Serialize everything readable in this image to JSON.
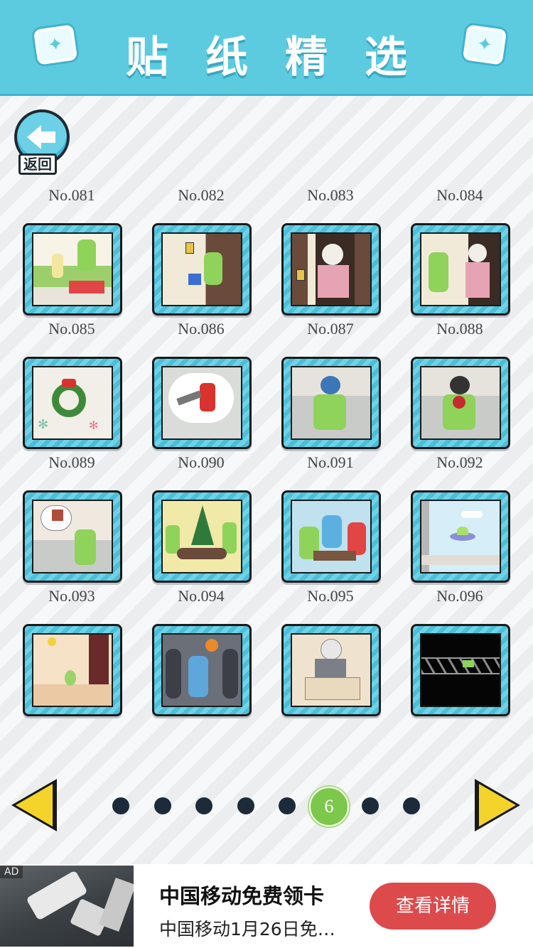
{
  "header": {
    "title": "贴纸精选",
    "left_icon": "star-card-icon",
    "right_icon": "star-card-icon"
  },
  "back_button": {
    "label": "返回",
    "icon": "arrow-left-icon"
  },
  "stickers": [
    {
      "label": "No.081",
      "scene": "boy-and-girl-outdoor"
    },
    {
      "label": "No.082",
      "scene": "boy-at-door"
    },
    {
      "label": "No.083",
      "scene": "woman-in-doorway"
    },
    {
      "label": "No.084",
      "scene": "delivery-at-door"
    },
    {
      "label": "No.085",
      "scene": "christmas-wreath"
    },
    {
      "label": "No.086",
      "scene": "santa-thought-bubble"
    },
    {
      "label": "No.087",
      "scene": "boy-holding-head"
    },
    {
      "label": "No.088",
      "scene": "boy-with-flowers"
    },
    {
      "label": "No.089",
      "scene": "boy-thinking-gift"
    },
    {
      "label": "No.090",
      "scene": "christmas-party"
    },
    {
      "label": "No.091",
      "scene": "friends-at-table"
    },
    {
      "label": "No.092",
      "scene": "ufo-window"
    },
    {
      "label": "No.093",
      "scene": "vase-room"
    },
    {
      "label": "No.094",
      "scene": "basketball-crowd"
    },
    {
      "label": "No.095",
      "scene": "old-man-at-desk"
    },
    {
      "label": "No.096",
      "scene": "dark-bridge"
    }
  ],
  "pagination": {
    "pages": [
      "",
      "",
      "",
      "",
      "",
      "6",
      "",
      ""
    ],
    "current": "6",
    "prev_icon": "triangle-left-icon",
    "next_icon": "triangle-right-icon"
  },
  "ad": {
    "tag": "AD",
    "title": "中国移动免费领卡",
    "subtitle": "中国移动1月26日免…",
    "button": "查看详情"
  },
  "colors": {
    "header": "#5ccbe0",
    "frame": "#6fd3e8",
    "active_page": "#7cc84a",
    "arrow": "#f4d42a",
    "ad_button": "#dd4a4c"
  }
}
